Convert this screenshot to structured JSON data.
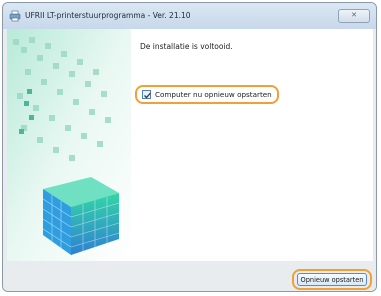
{
  "window": {
    "title": "UFRII LT-printerstuurprogramma - Ver. 21.10",
    "app_icon": "printer-icon",
    "close_label": "✕"
  },
  "content": {
    "message": "De installatie is voltooid.",
    "restart_checkbox": {
      "label": "Computer nu opnieuw opstarten",
      "checked": true
    }
  },
  "footer": {
    "primary_button_label": "Opnieuw opstarten"
  },
  "colors": {
    "highlight": "#f0a035",
    "art_green": "#2cc9a1",
    "art_blue": "#2f7fd3",
    "title_bar": "#c7d8ea"
  }
}
